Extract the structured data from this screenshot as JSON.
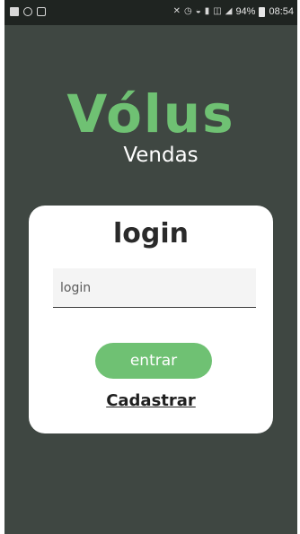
{
  "status_bar": {
    "left_icons": [
      "facebook-icon",
      "whatsapp-icon",
      "message-icon"
    ],
    "right_glyphs": [
      "mute-icon",
      "alarm-icon",
      "wifi-icon",
      "nfc-icon",
      "lte-icon",
      "signal-icon"
    ],
    "battery": "94%",
    "time": "08:54"
  },
  "logo": {
    "brand": "Vólus",
    "subtitle": "Vendas"
  },
  "login_card": {
    "title": "login",
    "input_placeholder": "login",
    "enter_label": "entrar",
    "register_label": "Cadastrar"
  },
  "colors": {
    "background": "#3f4742",
    "accent_green": "#6fc173",
    "card": "#ffffff",
    "status_bar": "#1f2421"
  }
}
